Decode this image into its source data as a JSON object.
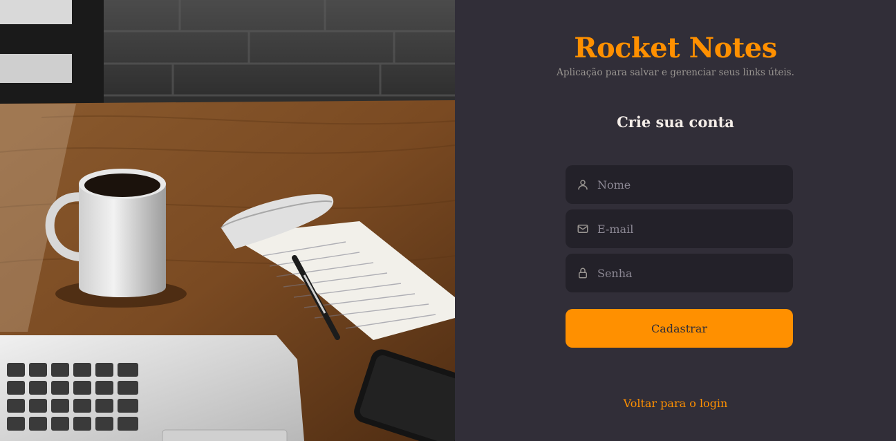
{
  "brand": {
    "title": "Rocket Notes",
    "tagline": "Aplicação para salvar e gerenciar seus links úteis."
  },
  "form": {
    "title": "Crie sua conta",
    "fields": [
      {
        "icon": "user-icon",
        "placeholder": "Nome",
        "value": ""
      },
      {
        "icon": "mail-icon",
        "placeholder": "E-mail",
        "value": ""
      },
      {
        "icon": "lock-icon",
        "placeholder": "Senha",
        "value": ""
      }
    ],
    "submit_label": "Cadastrar",
    "back_link_label": "Voltar para o login"
  },
  "background": {
    "image": "desk-photo"
  },
  "colors": {
    "accent": "#ff9000",
    "panel_bg": "#312e38",
    "input_bg": "#232129",
    "text": "#f4ede8",
    "muted": "#999591"
  }
}
